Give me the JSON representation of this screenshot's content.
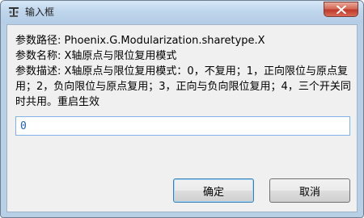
{
  "window": {
    "title": "输入框",
    "close_label": "关闭"
  },
  "description": {
    "path_line": "参数路径: Phoenix.G.Modularization.sharetype.X",
    "name_line": "参数名称: X轴原点与限位复用模式",
    "desc_line": "参数描述: X轴原点与限位复用模式：0，不复用；1，正向限位与原点复用；2，负向限位与原点复用；3，正向与负向限位复用；4，三个开关同时共用。重启生效"
  },
  "input": {
    "value": "0"
  },
  "buttons": {
    "ok_label": "确定",
    "cancel_label": "取消"
  },
  "colors": {
    "title_bar": "#bfd6ec",
    "close_button": "#c0392b",
    "input_border": "#7eb4ea",
    "dialog_bg": "#f0f0f0"
  },
  "icons": {
    "app": "app-tool-icon",
    "close": "close-icon"
  }
}
